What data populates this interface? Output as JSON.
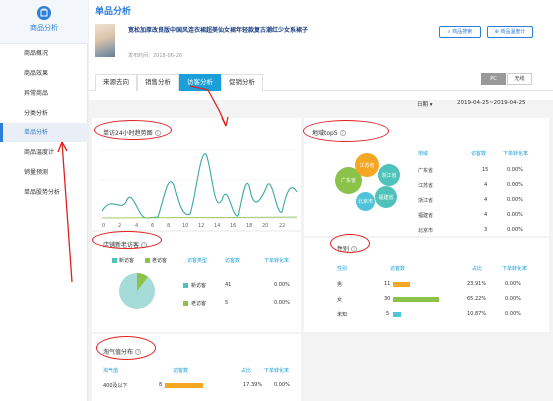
{
  "sidebar": {
    "title": "商品分析",
    "items": [
      {
        "label": "商品概况"
      },
      {
        "label": "商品效果"
      },
      {
        "label": "异常商品"
      },
      {
        "label": "分类分析"
      },
      {
        "label": "单品分析"
      },
      {
        "label": "商品温度计"
      },
      {
        "label": "销量预测"
      },
      {
        "label": "单品股势分析"
      }
    ]
  },
  "header": {
    "page_title": "单品分析",
    "product_name": "宽松加厚改良版中国风连衣裙超美仙女裙年轻款复古潮红少女系裙子",
    "publish_time": "发布时间：2018-06-26",
    "btn_search": "商品搜索",
    "btn_thermo": "商品温度计"
  },
  "tabs": [
    "来源去向",
    "销售分析",
    "访客分析",
    "促销分析"
  ],
  "device": {
    "pc": "PC",
    "wireless": "无线"
  },
  "date": {
    "granularity": "日期 ▾",
    "range": "2019-04-25~2019-04-25"
  },
  "visitor_24h": {
    "title": "单访24小时趋势图",
    "x_ticks": [
      "0",
      "2",
      "4",
      "6",
      "8",
      "10",
      "12",
      "14",
      "16",
      "18",
      "20",
      "22"
    ]
  },
  "new_old": {
    "title": "店铺新老访客",
    "legend_new": "新访客",
    "legend_old": "老访客",
    "headers": [
      "访客类型",
      "访客数",
      "下单转化率"
    ],
    "rows": [
      {
        "type": "新访客",
        "count": "41",
        "rate": "0.00%"
      },
      {
        "type": "老访客",
        "count": "5",
        "rate": "0.00%"
      }
    ]
  },
  "region": {
    "title": "地域top5",
    "bubbles": [
      "江苏省",
      "广东省",
      "浙江省",
      "福建省",
      "北京市"
    ],
    "headers": [
      "地域",
      "访客数",
      "下单转化率"
    ],
    "rows": [
      {
        "name": "广东省",
        "count": "15",
        "rate": "0.00%"
      },
      {
        "name": "江苏省",
        "count": "4",
        "rate": "0.00%"
      },
      {
        "name": "浙江省",
        "count": "4",
        "rate": "0.00%"
      },
      {
        "name": "福建省",
        "count": "4",
        "rate": "0.00%"
      },
      {
        "name": "北京市",
        "count": "3",
        "rate": "0.00%"
      }
    ]
  },
  "gender": {
    "title": "性别",
    "headers": [
      "性别",
      "访客数",
      "占比",
      "下单转化率"
    ],
    "rows": [
      {
        "name": "男",
        "count": "11",
        "share": "23.91%",
        "rate": "0.00%",
        "fill": 0.2391,
        "color": "#f5a623"
      },
      {
        "name": "女",
        "count": "30",
        "share": "65.22%",
        "rate": "0.00%",
        "fill": 0.6522,
        "color": "#8bc34a"
      },
      {
        "name": "未知",
        "count": "5",
        "share": "10.87%",
        "rate": "0.00%",
        "fill": 0.1087,
        "color": "#4fc3d9"
      }
    ]
  },
  "naughty": {
    "title": "淘气值分布",
    "headers": [
      "淘气值",
      "访客数",
      "占比",
      "下单转化率"
    ],
    "rows": [
      {
        "name": "400及以下",
        "count": "8",
        "share": "17.39%",
        "rate": "0.00%",
        "fill": 0.1739,
        "color": "#f5a623"
      }
    ]
  },
  "colors": {
    "accent": "#2d7ed8",
    "tab_active": "#1a9fd8",
    "line": "#3aa8a0",
    "annotation": "#e02020"
  }
}
